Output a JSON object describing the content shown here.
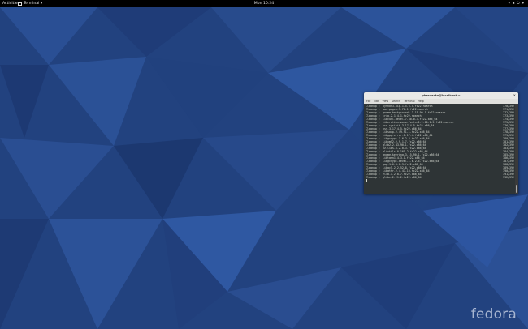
{
  "topbar": {
    "activities": "Activities",
    "app_menu": "Terminal ▾",
    "clock": "Mon 10:24",
    "status_icons": [
      "network-icon",
      "volume-icon",
      "power-icon",
      "menu-arrow-icon"
    ]
  },
  "terminal": {
    "title": "pharvanto@localhost:~",
    "menu": [
      "File",
      "Edit",
      "View",
      "Search",
      "Terminal",
      "Help"
    ],
    "rows": [
      {
        "action": "Cleanup",
        "pkg": "python3-pip-1.5.6-5.fc22.noarch",
        "count": "370/392"
      },
      {
        "action": "Cleanup",
        "pkg": "man-pages-3.70-1.fc22.noarch",
        "count": "371/392"
      },
      {
        "action": "Cleanup",
        "pkg": "gnome-backgrounds-3.15.90-1.fc22.noarch",
        "count": "372/392"
      },
      {
        "action": "Cleanup",
        "pkg": "trio-2.1.4-1.fc22.noarch",
        "count": "373/392"
      },
      {
        "action": "Cleanup",
        "pkg": "libcurl-devel-7.40.0-3.fc22.x86_64",
        "count": "374/392"
      },
      {
        "action": "Cleanup",
        "pkg": "liberation-mono-fonts-1:2.00.1-5.fc22.noarch",
        "count": "375/392"
      },
      {
        "action": "Cleanup",
        "pkg": "nss-sysinit-3.17.4-5.fc22.x86_64",
        "count": "376/392"
      },
      {
        "action": "Cleanup",
        "pkg": "nss-3.17.4-5.fc22.x86_64",
        "count": "377/392"
      },
      {
        "action": "Cleanup",
        "pkg": "libsoup-2.49.91-1.fc22.x86_64",
        "count": "378/392"
      },
      {
        "action": "Cleanup",
        "pkg": "libgpg-error-1.17-4.fc22.x86_64",
        "count": "379/392"
      },
      {
        "action": "Cleanup",
        "pkg": "libgcrypt-1.6.2-4.fc22.x86_64",
        "count": "380/392"
      },
      {
        "action": "Cleanup",
        "pkg": "libxml2-2.9.1-7.fc22.x86_64",
        "count": "381/392"
      },
      {
        "action": "Cleanup",
        "pkg": "glib2-2.43.90-1.fc22.x86_64",
        "count": "382/392"
      },
      {
        "action": "Cleanup",
        "pkg": "xz-libs-5.2.0-3.fc22.x86_64",
        "count": "383/392"
      },
      {
        "action": "Cleanup",
        "pkg": "elfutils-0.161-2.fc22.x86_64",
        "count": "384/392"
      },
      {
        "action": "Cleanup",
        "pkg": "gnome-keyring-3.15.90-1.fc22.x86_64",
        "count": "385/392"
      },
      {
        "action": "Cleanup",
        "pkg": "libtasn1-4.3-1.fc22.x86_64",
        "count": "386/392"
      },
      {
        "action": "Cleanup",
        "pkg": "libgcrypt-devel-1.6.2-4.fc22.x86_64",
        "count": "387/392"
      },
      {
        "action": "Cleanup",
        "pkg": "gmp-1:6.0.0-9.fc22.x86_64",
        "count": "388/392"
      },
      {
        "action": "Cleanup",
        "pkg": "libacl-2.2.52-8.fc22.x86_64",
        "count": "389/392"
      },
      {
        "action": "Cleanup",
        "pkg": "libattr-2.4.47-10.fc22.x86_64",
        "count": "390/392"
      },
      {
        "action": "Cleanup",
        "pkg": "zlib-1.2.8-7.fc22.x86_64",
        "count": "391/392"
      },
      {
        "action": "Cleanup",
        "pkg": "glibc-2.21-2.fc22.x86_64",
        "count": "392/392"
      }
    ]
  },
  "branding": {
    "logo_text": "fedora"
  },
  "colors": {
    "wallpaper_base": "#22427f",
    "topbar": "#000000",
    "terminal_bg": "#2e3436"
  }
}
